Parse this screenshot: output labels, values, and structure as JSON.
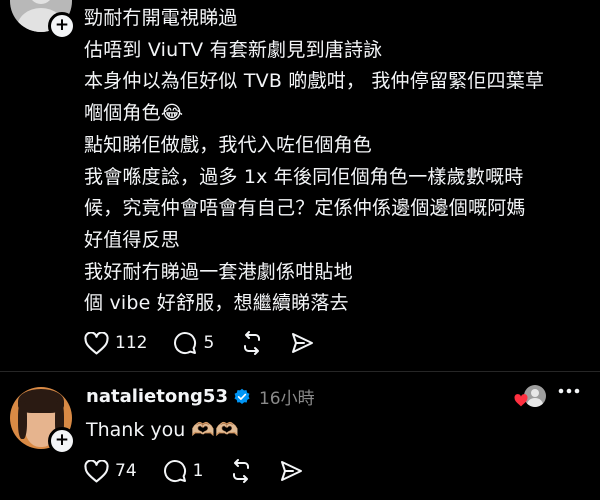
{
  "post": {
    "lines": [
      "勁耐冇開電視睇過",
      "估唔到 ViuTV 有套新劇見到唐詩詠",
      "本身仲以為佢好似 TVB 啲戲咁， 我仲停留緊佢四葉草",
      "嗰個角色",
      "點知睇佢做戲，我代入咗佢個角色",
      "我會喺度諗，過多 1x 年後同佢個角色一樣歲數嘅時",
      "候，究竟仲會唔會有自己？定係仲係邊個邊個嘅阿媽",
      "好值得反思",
      "我好耐冇睇過一套港劇係咁貼地",
      "個 vibe 好舒服，想繼續睇落去"
    ],
    "emoji": "😂",
    "likes": "112",
    "comments": "5"
  },
  "reply": {
    "username": "natalietong53",
    "time": "16小時",
    "text": "Thank you",
    "emoji": "🫶🏼🫶🏼",
    "likes": "74",
    "comments": "1"
  },
  "icons": [
    "plus-icon",
    "heart-icon",
    "comment-icon",
    "repost-icon",
    "share-icon",
    "verified-icon",
    "more-icon",
    "liked-by-author-icon"
  ],
  "colors": {
    "background": "#000000",
    "text": "#f3f5f7",
    "muted": "#8a8a8a",
    "verified": "#0095f6",
    "heart": "#ff3040"
  }
}
